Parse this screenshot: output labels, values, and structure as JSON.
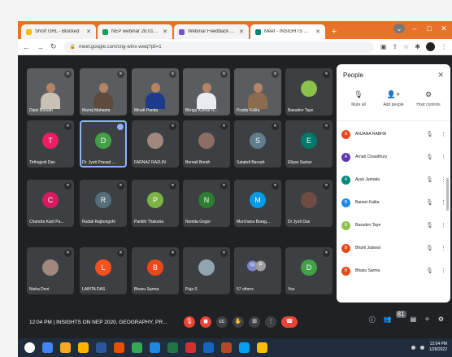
{
  "tabs": [
    {
      "label": "Short URL - Blocked",
      "favicon_color": "#fbbc04",
      "active": false
    },
    {
      "label": "NEP webinar 28.01.2022 - Googl",
      "favicon_color": "#0f9d58",
      "active": false
    },
    {
      "label": "Webinar Feedback form_Insight",
      "favicon_color": "#7b4fc9",
      "active": false
    },
    {
      "label": "Meet - INSIGHTS ON NEP 2",
      "favicon_color": "#00897b",
      "active": true
    }
  ],
  "newtab_symbol": "+",
  "window_controls": {
    "minimize": "–",
    "maximize": "□",
    "close": "✕"
  },
  "url": "meet.google.com/cng-winx-wwq?pli=1",
  "participants": [
    {
      "name": "Dipul Baruah",
      "type": "video",
      "body_color": "#c9c2b4"
    },
    {
      "name": "Manoj Mahanta",
      "type": "video",
      "body_color": "#5e4b3b"
    },
    {
      "name": "Minati Panda",
      "type": "video",
      "body_color": "#1e3a8a"
    },
    {
      "name": "Bhrigu Kumar N...",
      "type": "video",
      "body_color": "#e8ebef"
    },
    {
      "name": "Pradip Kalita",
      "type": "video",
      "body_color": "#8d6b4f"
    },
    {
      "name": "Basudev Taye",
      "type": "photo",
      "color": "#8bc34a"
    },
    {
      "name": "Tirthajyoti Das",
      "type": "initial",
      "initial": "T",
      "color": "#e91e63"
    },
    {
      "name": "Dr. Jyoti Prasad ...",
      "type": "initial",
      "initial": "D",
      "color": "#43a047",
      "highlight": true
    },
    {
      "name": "FARNAZ RAZLIN",
      "type": "photo",
      "color": "#a1887f"
    },
    {
      "name": "Bornali Borah",
      "type": "photo",
      "color": "#8d6e63"
    },
    {
      "name": "Satabdi Baruah",
      "type": "initial",
      "initial": "S",
      "color": "#607d8b"
    },
    {
      "name": "Ellyas Sarkar",
      "type": "initial",
      "initial": "E",
      "color": "#00796b"
    },
    {
      "name": "Chandra Kant Pa...",
      "type": "initial",
      "initial": "C",
      "color": "#d81b60"
    },
    {
      "name": "Rudali Rajbongshi",
      "type": "initial",
      "initial": "R",
      "color": "#546e7a"
    },
    {
      "name": "Parikhi Thakuria",
      "type": "initial",
      "initial": "P",
      "color": "#7cb342"
    },
    {
      "name": "Nomita Gogoi",
      "type": "initial",
      "initial": "N",
      "color": "#2e7d32"
    },
    {
      "name": "Murchana Burag...",
      "type": "initial",
      "initial": "M",
      "color": "#039be5"
    },
    {
      "name": "Dr Jyoti Das",
      "type": "photo",
      "color": "#6d4c41"
    },
    {
      "name": "Nisha Devi",
      "type": "photo",
      "color": "#a1887f"
    },
    {
      "name": "LABITA DAS",
      "type": "initial",
      "initial": "L",
      "color": "#f4511e"
    },
    {
      "name": "Bhasu Sarma",
      "type": "initial",
      "initial": "B",
      "color": "#e64a19"
    },
    {
      "name": "Puja S",
      "type": "photo",
      "color": "#90a4ae"
    },
    {
      "name": "57 others",
      "type": "others",
      "initials": [
        "M",
        "P"
      ]
    },
    {
      "name": "You",
      "type": "initial",
      "initial": "D",
      "color": "#43a047"
    }
  ],
  "people_panel": {
    "title": "People",
    "close_icon": "✕",
    "actions": [
      {
        "label": "Mute all",
        "icon": "🎙"
      },
      {
        "label": "Add people",
        "icon": "👤+"
      },
      {
        "label": "Host controls",
        "icon": "⚙"
      }
    ],
    "list": [
      {
        "name": "ANJANA RABHA",
        "initial": "A",
        "color": "#e64a19"
      },
      {
        "name": "Arnab Chaudhury",
        "initial": "A",
        "color": "#5e35b1"
      },
      {
        "name": "Ayuk Jamatia",
        "initial": "A",
        "color": "#00897b"
      },
      {
        "name": "Banani Kalita",
        "initial": "B",
        "color": "#1e88e5"
      },
      {
        "name": "Basudev Taye",
        "initial": "B",
        "color": "#8bc34a"
      },
      {
        "name": "Bharti Jaiswal",
        "initial": "B",
        "color": "#e64a19"
      },
      {
        "name": "Bhasu Sarma",
        "initial": "B",
        "color": "#e64a19"
      }
    ]
  },
  "meeting_info": "12:04 PM | INSIGHTS ON NEP 2020, GEOGRAPHY, PR...",
  "participant_count": "81",
  "taskbar_clock": {
    "time": "12:04 PM",
    "date": "1/28/2022"
  },
  "taskbar_apps": [
    "#4285f4",
    "#f9a825",
    "#ffb300",
    "#2b579a",
    "#e65100",
    "#34a853",
    "#1e88e5",
    "#217346",
    "#d32f2f",
    "#1565c0",
    "#b7472a",
    "#00a1f1",
    "#fbbc04"
  ]
}
